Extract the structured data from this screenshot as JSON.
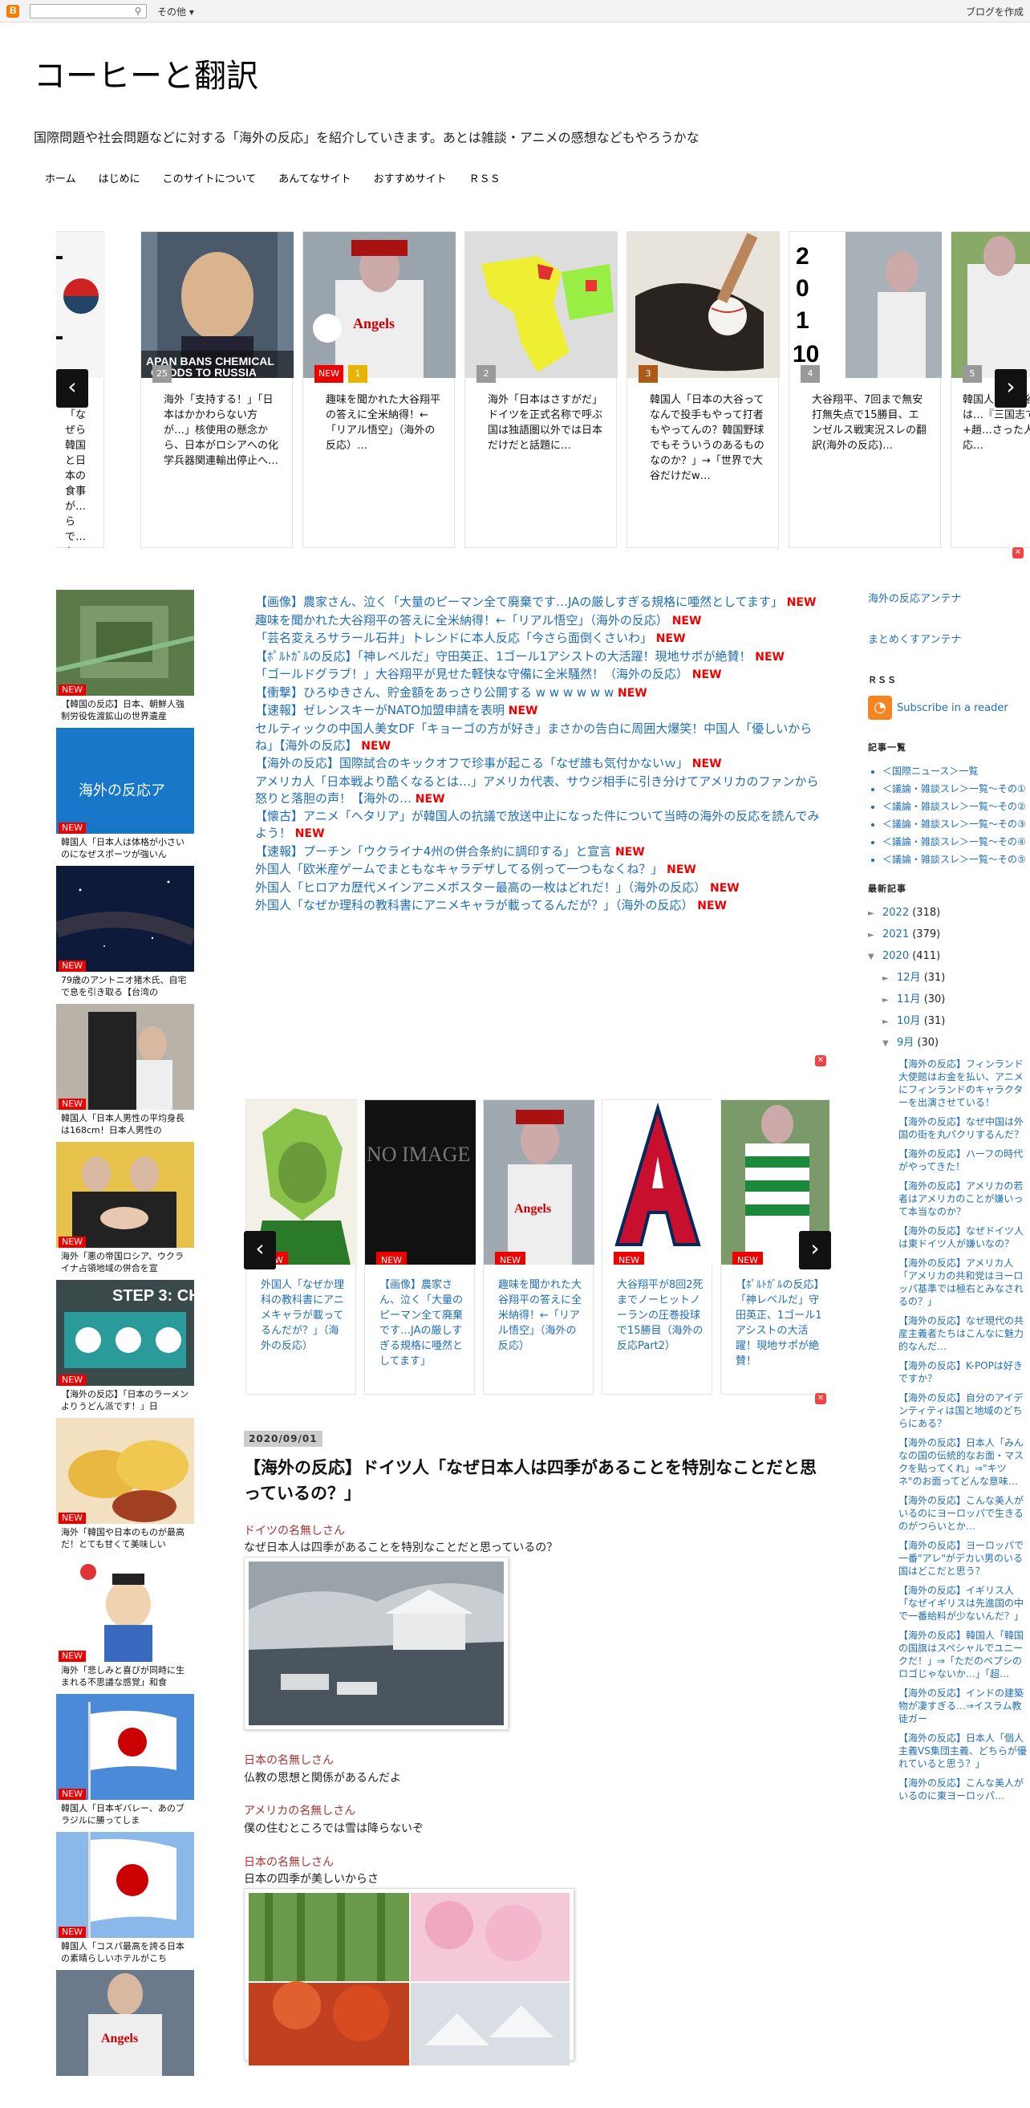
{
  "navbar": {
    "more": "その他",
    "create_blog": "ブログを作成",
    "search_placeholder": ""
  },
  "header": {
    "title": "コーヒーと翻訳",
    "description": "国際問題や社会問題などに対する「海外の反応」を紹介していきます。あとは雑談・アニメの感想などもやろうかな"
  },
  "tabs": [
    "ホーム",
    "はじめに",
    "このサイトについて",
    "あんてなサイト",
    "おすすめサイト",
    "ＲＳＳ"
  ],
  "carousel1": [
    {
      "rank": "",
      "new": false,
      "text": "海外「なぜら韓国と日本の食事が…らで…ち」韓国人「意…なぜなんだ"
    },
    {
      "rank": "25",
      "new": false,
      "text": "海外「支持する！」「日本はかかわらない方が…」核使用の懸念から、日本がロシアへの化学兵器関連輸出停止へ…"
    },
    {
      "rank": "1",
      "new": true,
      "text": "趣味を聞かれた大谷翔平の答えに全米納得！←「リアル悟空」（海外の反応）…"
    },
    {
      "rank": "2",
      "new": false,
      "text": "海外「日本はさすがだ」ドイツを正式名称で呼ぶ国は独語圏以外では日本だけだと話題に…"
    },
    {
      "rank": "3",
      "new": false,
      "text": "韓国人「日本の大谷ってなんで投手もやって打者もやってんの？韓国野球でもそういうのあるものなのか？」→「世界で大谷だけだw…"
    },
    {
      "rank": "4",
      "new": false,
      "text": "大谷翔平、7回まで無安打無失点で15勝目、エンゼルス戦実況スレの翻訳(海外の反応)…"
    },
    {
      "rank": "5",
      "new": false,
      "text": "韓国人…が大谷を…「大谷は…『三国志で…諸葛亮+趙…さった人物…国の反応…"
    }
  ],
  "left_sidebar": [
    {
      "caption": "【韓国の反応】日本、朝鮮人強制労役佐渡鉱山の世界遺産",
      "new": true
    },
    {
      "caption": "韓国人「日本人は体格が小さいのになぜスポーツが強いん",
      "new": true
    },
    {
      "caption": "79歳のアントニオ猪木氏、自宅で息を引き取る【台湾の",
      "new": true
    },
    {
      "caption": "韓国人「日本人男性の平均身長は168cm！日本人男性の",
      "new": true
    },
    {
      "caption": "海外「悪の帝国ロシア、ウクライナ占領地域の併合を宣",
      "new": true
    },
    {
      "caption": "【海外の反応】「日本のラーメンよりうどん派です！」日",
      "new": true
    },
    {
      "caption": "海外「韓国や日本のものが最高だ！とても甘くて美味しい",
      "new": true
    },
    {
      "caption": "海外「悲しみと喜びが同時に生まれる不思議な感覚」和食",
      "new": true
    },
    {
      "caption": "韓国人「日本ギバレー、あのブラジルに勝ってしま",
      "new": true
    },
    {
      "caption": "韓国人「コスパ最高を誇る日本の素晴らしいホテルがこち",
      "new": true
    },
    {
      "caption": "",
      "new": false
    }
  ],
  "link_list": [
    {
      "text": "【画像】農家さん、泣く「大量のピーマン全て廃棄です…JAの厳しすぎる規格に唖然としてます」",
      "new": "NEW"
    },
    {
      "text": "趣味を聞かれた大谷翔平の答えに全米納得！←「リアル悟空」（海外の反応）",
      "new": "NEW"
    },
    {
      "text": "「芸名変えろサラール石井」トレンドに本人反応「今さら面倒くさいわ」",
      "new": "NEW"
    },
    {
      "text": "【ﾎﾟﾙﾄｶﾞﾙの反応】「神レベルだ」守田英正、1ゴール1アシストの大活躍！現地サポが絶賛！",
      "new": "NEW"
    },
    {
      "text": "「ゴールドグラブ！」大谷翔平が見せた軽快な守備に全米騒然！（海外の反応）",
      "new": "NEW"
    },
    {
      "text": "【衝撃】ひろゆきさん、貯金額をあっさり公開する w w w w w w",
      "new": "NEW"
    },
    {
      "text": "【速報】ゼレンスキーがNATO加盟申請を表明",
      "new": "NEW"
    },
    {
      "text": "セルティックの中国人美女DF「キョーゴの方が好き」まさかの告白に周囲大爆笑！中国人「優しいからね」【海外の反応】",
      "new": "NEW"
    },
    {
      "text": "【海外の反応】国際試合のキックオフで珍事が起こる「なぜ誰も気付かないｗ」",
      "new": "NEW"
    },
    {
      "text": "アメリカ人「日本戦より酷くなるとは…」アメリカ代表、サウジ相手に引き分けてアメリカのファンから怒りと落胆の声！【海外の…",
      "new": "NEW"
    },
    {
      "text": "【懐古】アニメ「ヘタリア」が韓国人の抗議で放送中止になった件について当時の海外の反応を読んでみよう！",
      "new": "NEW"
    },
    {
      "text": "【速報】プーチン「ウクライナ4州の併合条約に調印する」と宣言",
      "new": "NEW"
    },
    {
      "text": "外国人「欧米産ゲームでまともなキャラデザしてる例って一つもなくね？」",
      "new": "NEW"
    },
    {
      "text": "外国人「ヒロアカ歴代メインアニメポスター最高の一枚はどれだ！」（海外の反応）",
      "new": "NEW"
    },
    {
      "text": "外国人「なぜか理科の教科書にアニメキャラが載ってるんだが？」（海外の反応）",
      "new": "NEW"
    }
  ],
  "carousel2": [
    {
      "new": "NEW",
      "text": "外国人「なぜか理科の教科書にアニメキャラが載ってるんだが？」（海外の反応）",
      "noimage": ""
    },
    {
      "new": "NEW",
      "text": "【画像】農家さん、泣く「大量のピーマン全て廃棄です…JAの厳しすぎる規格に唖然としてます」",
      "noimage": "NO IMAGE"
    },
    {
      "new": "NEW",
      "text": "趣味を聞かれた大谷翔平の答えに全米納得！←「リアル悟空」（海外の反応）",
      "noimage": ""
    },
    {
      "new": "NEW",
      "text": "大谷翔平が8回2死までノーヒットノーランの圧巻投球で15勝目（海外の反応Part2）",
      "noimage": ""
    },
    {
      "new": "NEW",
      "text": "【ﾎﾟﾙﾄｶﾞﾙの反応】「神レベルだ」守田英正、1ゴール1アシストの大活躍！現地サポが絶賛！",
      "noimage": ""
    }
  ],
  "post": {
    "date": "2020/09/01",
    "title": "【海外の反応】ドイツ人「なぜ日本人は四季があることを特別なことだと思っているの？」",
    "comments": [
      {
        "author": "ドイツの名無しさん",
        "body": "なぜ日本人は四季があることを特別なことだと思っているの？"
      },
      {
        "author": "日本の名無しさん",
        "body": "仏教の思想と関係があるんだよ"
      },
      {
        "author": "アメリカの名無しさん",
        "body": "僕の住むところでは雪は降らないぞ"
      },
      {
        "author": "日本の名無しさん",
        "body": "日本の四季が美しいからさ"
      }
    ]
  },
  "right_sidebar": {
    "antenna1": "海外の反応アンテナ",
    "antenna2": "まとめくすアンテナ",
    "rss_head": "ＲＳＳ",
    "rss_link": "Subscribe in a reader",
    "kiji_head": "記事一覧",
    "kiji": [
      "＜国際ニュース＞一覧",
      "＜議論・雑談スレ＞一覧～その①",
      "＜議論・雑談スレ＞一覧～その②",
      "＜議論・雑談スレ＞一覧～その③",
      "＜議論・雑談スレ＞一覧～その④",
      "＜議論・雑談スレ＞一覧～その⑤"
    ],
    "recent_head": "最新記事",
    "archive": [
      {
        "tri": "►",
        "label": "2022",
        "count": "(318)"
      },
      {
        "tri": "►",
        "label": "2021",
        "count": "(379)"
      },
      {
        "tri": "▼",
        "label": "2020",
        "count": "(411)"
      }
    ],
    "months": [
      {
        "tri": "►",
        "label": "12月",
        "count": "(31)"
      },
      {
        "tri": "►",
        "label": "11月",
        "count": "(30)"
      },
      {
        "tri": "►",
        "label": "10月",
        "count": "(31)"
      },
      {
        "tri": "▼",
        "label": "9月",
        "count": "(30)"
      }
    ],
    "posts": [
      "【海外の反応】フィンランド大使館はお金を払い、アニメにフィンランドのキャラクターを出演させている！",
      "【海外の反応】なぜ中国は外国の街を丸パクリするんだ？",
      "【海外の反応】ハーフの時代がやってきた！",
      "【海外の反応】アメリカの若者はアメリカのことが嫌いって本当なのか？",
      "【海外の反応】なぜドイツ人は東ドイツ人が嫌いなの？",
      "【海外の反応】アメリカ人「アメリカの共和党はヨーロッパ基準では極右とみなされるの？」",
      "【海外の反応】なぜ現代の共産主義者たちはこんなに魅力的なんだ…",
      "【海外の反応】K-POPは好きですか？",
      "【海外の反応】自分のアイデンティティは国と地域のどちらにある？",
      "【海外の反応】日本人「みんなの国の伝統的なお面・マスクを貼ってくれ」⇒\"キツネ\"のお面ってどんな意味…",
      "【海外の反応】こんな美人がいるのにヨーロッパで生きるのがつらいとか…",
      "【海外の反応】ヨーロッパで一番\"アレ\"がデカい男のいる国はどこだと思う？",
      "【海外の反応】イギリス人「なぜイギリスは先進国の中で一番給料が少ないんだ？」",
      "【海外の反応】韓国人「韓国の国旗はスペシャルでユニークだ！」⇒「ただのペプシのロゴじゃないか…」「超…",
      "【海外の反応】インドの建築物が凄すぎる…⇒イスラム教徒ガー",
      "【海外の反応】日本人「個人主義VS集団主義、どちらが優れていると思う？」",
      "【海外の反応】こんな美人がいるのに東ヨーロッパ…"
    ]
  }
}
